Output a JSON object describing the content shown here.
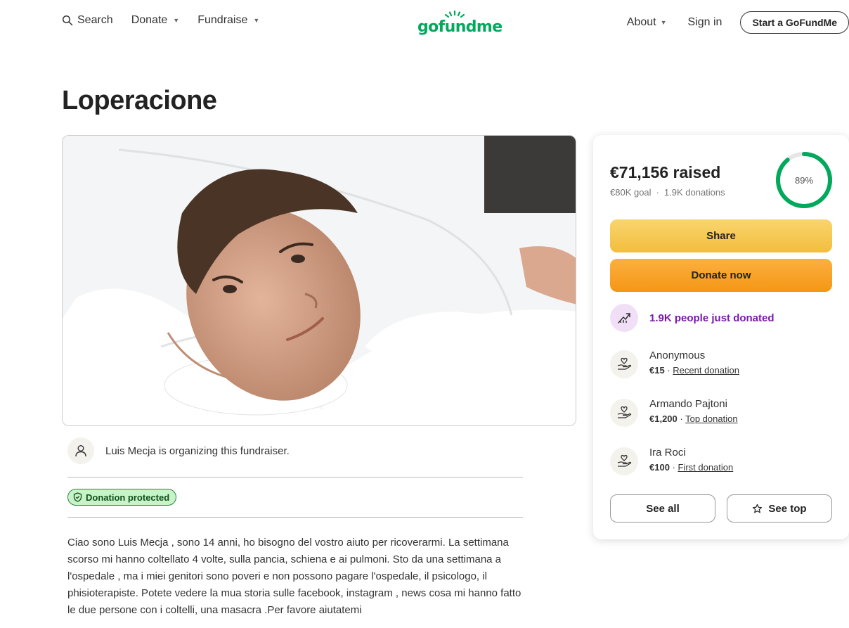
{
  "nav": {
    "search_label": "Search",
    "donate_label": "Donate",
    "fundraise_label": "Fundraise",
    "logo_text": "gofundme",
    "about_label": "About",
    "signin_label": "Sign in",
    "start_label": "Start a GoFundMe"
  },
  "campaign": {
    "title": "Loperacione",
    "organizer_text": "Luis Mecja is organizing this fundraiser.",
    "protected_label": "Donation protected",
    "story": "Ciao sono Luis Mecja , sono 14 anni, ho bisogno del vostro aiuto per ricoverarmi. La settimana scorso mi hanno coltellato 4 volte, sulla pancia, schiena e ai pulmoni. Sto da una settimana a l'ospedale , ma i miei genitori sono poveri e non possono pagare l'ospedale, il psicologo, il phisioterapiste. Potete vedere la mua storia sulle facebook, instagram , news cosa mi hanno fatto le due persone con i coltelli, una masacra .Per favore aiutatemi"
  },
  "card": {
    "raised": "€71,156 raised",
    "goal": "€80K goal",
    "donations": "1.9K donations",
    "progress_percent": 89,
    "progress_label": "89%",
    "share_label": "Share",
    "donate_label": "Donate now",
    "trend_text": "1.9K people just donated",
    "donors": [
      {
        "name": "Anonymous",
        "amount": "€15",
        "tag": "Recent donation"
      },
      {
        "name": "Armando Pajtoni",
        "amount": "€1,200",
        "tag": "Top donation"
      },
      {
        "name": "Ira Roci",
        "amount": "€100",
        "tag": "First donation"
      }
    ],
    "see_all_label": "See all",
    "see_top_label": "See top"
  },
  "colors": {
    "brand_green": "#02a95c",
    "share_yellow": "#f6c94f",
    "donate_orange": "#f8a427",
    "trend_purple": "#7a19a8",
    "protected_green": "#c9f2c9"
  }
}
